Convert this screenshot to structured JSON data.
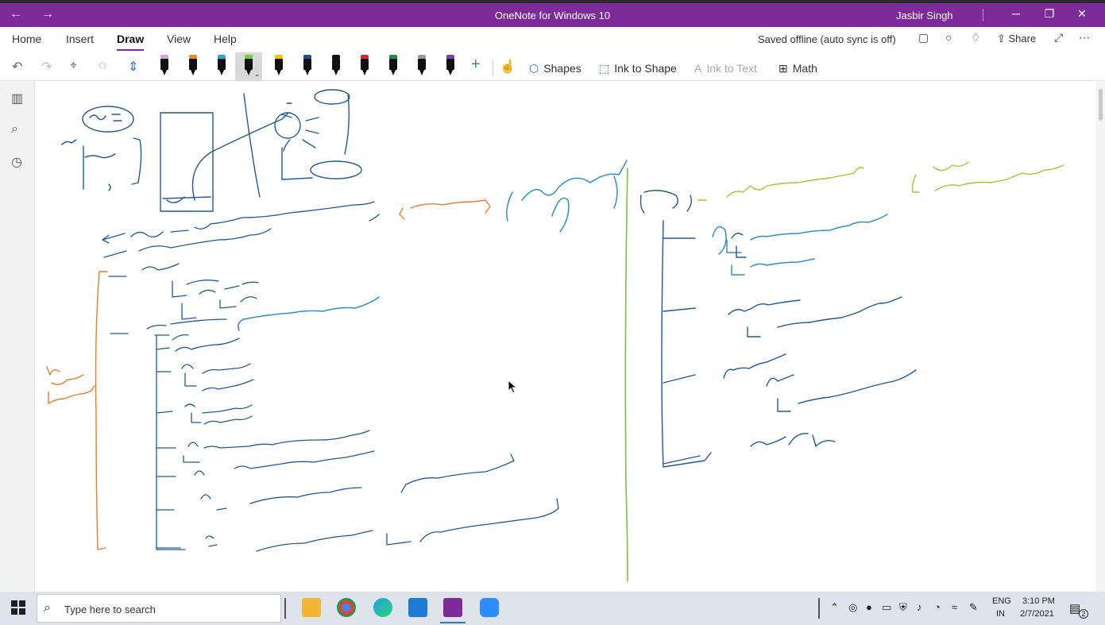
{
  "titlebar": {
    "title": "OneNote for Windows 10",
    "user": "Jasbir Singh",
    "back_glyph": "←",
    "forward_glyph": "→",
    "minimize_glyph": "─",
    "maximize_glyph": "❐",
    "close_glyph": "✕"
  },
  "ribbon": {
    "tabs": [
      "Home",
      "Insert",
      "Draw",
      "View",
      "Help"
    ],
    "active_tab": "Draw",
    "status": "Saved offline (auto sync is off)",
    "share_label": "Share"
  },
  "toolbar": {
    "pens": [
      {
        "name": "pen-pink",
        "band": "#d9a3d8",
        "body": "#111111"
      },
      {
        "name": "pen-orange",
        "band": "#f08a1c",
        "body": "#111111"
      },
      {
        "name": "pen-cyan",
        "band": "#2aa6d8",
        "body": "#111111"
      },
      {
        "name": "pen-green-selected",
        "band": "#7ac943",
        "body": "#111111",
        "selected": true
      },
      {
        "name": "pen-yellow",
        "band": "#f2c40f",
        "body": "#111111"
      },
      {
        "name": "pen-navy",
        "band": "#1f4f8c",
        "body": "#111111"
      },
      {
        "name": "pen-black",
        "band": "#111111",
        "body": "#111111"
      },
      {
        "name": "pen-red",
        "band": "#e0242b",
        "body": "#111111"
      },
      {
        "name": "pen-dark-green",
        "band": "#1e8c3a",
        "body": "#111111"
      },
      {
        "name": "pen-gray",
        "band": "#9a9a9a",
        "body": "#111111"
      },
      {
        "name": "pen-purple",
        "band": "#7b3fb0",
        "body": "#111111"
      }
    ],
    "shapes_label": "Shapes",
    "ink_to_shape_label": "Ink to Shape",
    "ink_to_text_label": "Ink to Text",
    "math_label": "Math"
  },
  "ink_colors": {
    "blue": "#1d5a9a",
    "light_blue": "#2f8fd0",
    "orange": "#ef7b2b",
    "green": "#7cc23a",
    "yellow_green": "#a5c62a"
  },
  "taskbar": {
    "search_placeholder": "Type here to search",
    "lang_line1": "ENG",
    "lang_line2": "IN",
    "time": "3:10 PM",
    "date": "2/7/2021",
    "notification_count": "2"
  }
}
